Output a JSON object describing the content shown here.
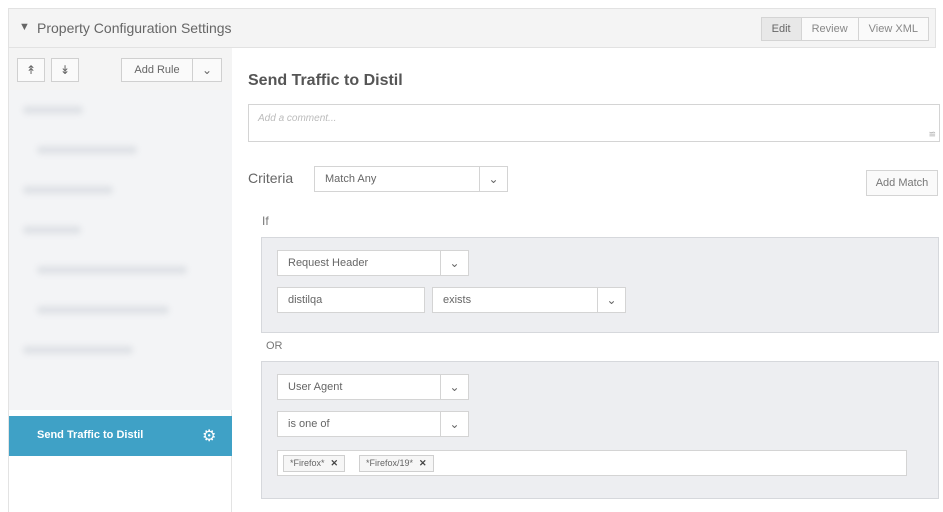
{
  "header": {
    "title": "Property Configuration Settings",
    "modes": [
      "Edit",
      "Review",
      "View XML"
    ],
    "active_mode": "Edit"
  },
  "left_panel": {
    "toolbar": {
      "collapse_all_icon": "double-chevron-up-icon",
      "expand_all_icon": "double-chevron-down-icon",
      "add_rule_label": "Add Rule"
    },
    "active_rule": {
      "label": "Send Traffic to Distil",
      "icon": "gear-icon"
    }
  },
  "main": {
    "rule_title": "Send Traffic to Distil",
    "comment_placeholder": "Add a comment...",
    "criteria_label": "Criteria",
    "criteria_value": "Match Any",
    "add_match_label": "Add Match",
    "if_label": "If",
    "or_label": "OR",
    "match1": {
      "type": "Request Header",
      "name": "distilqa",
      "operator": "exists"
    },
    "match2": {
      "type": "User Agent",
      "operator": "is one of",
      "tags": [
        "*Firefox*",
        "*Firefox/19*"
      ]
    }
  },
  "colors": {
    "accent": "#3fa1c6",
    "group_bg": "#edeef1"
  }
}
